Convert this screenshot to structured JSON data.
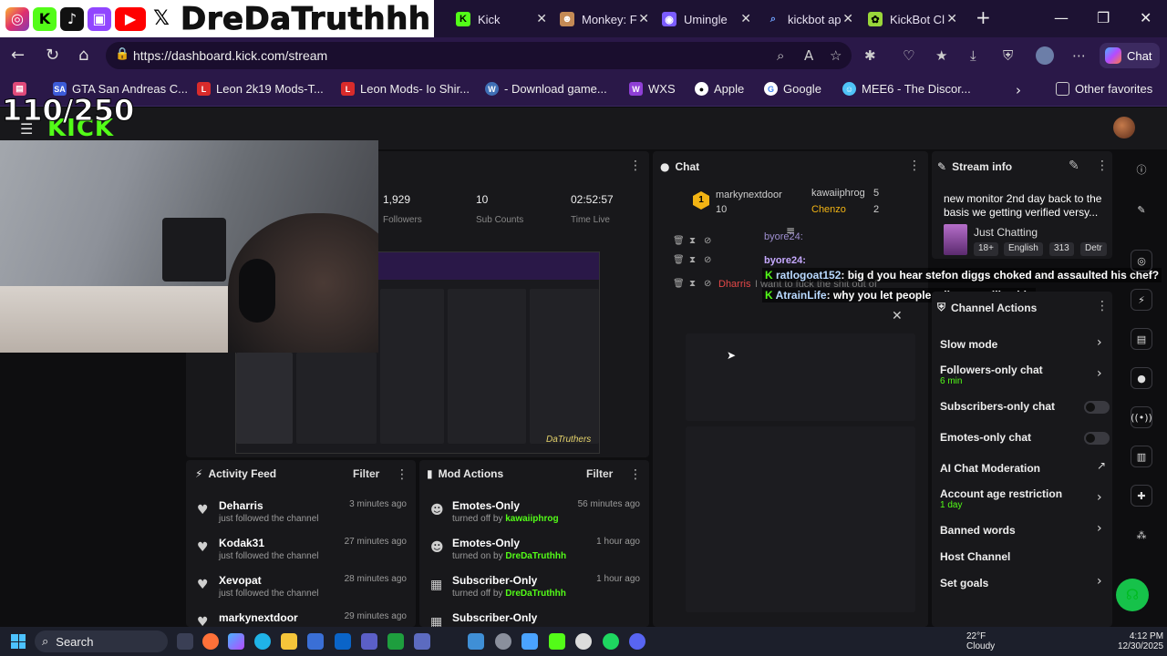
{
  "overlay": {
    "channel_name": "DreDaTruthhh",
    "viewer_goal": "110/250"
  },
  "browser": {
    "tabs": [
      {
        "label": "Kick",
        "color": "#53fc18",
        "icon": "K"
      },
      {
        "label": "Monkey: F",
        "color": "#c48a55",
        "icon": "M"
      },
      {
        "label": "Umingle",
        "color": "#7b5cff",
        "icon": "U"
      },
      {
        "label": "kickbot ap",
        "color": "#3c7bff",
        "icon": "Q"
      },
      {
        "label": "KickBot Cl",
        "color": "#9ad63a",
        "icon": "B"
      }
    ],
    "url": "https://dashboard.kick.com/stream",
    "chat_button_label": "Chat",
    "bookmarks": [
      {
        "label": "GTA San Andreas C...",
        "color": "#3c5bd8",
        "icon": "SA"
      },
      {
        "label": "Leon 2k19 Mods-T...",
        "color": "#d92b2b",
        "icon": "L"
      },
      {
        "label": "Leon Mods- Io Shir...",
        "color": "#d92b2b",
        "icon": "L"
      },
      {
        "label": "- Download game...",
        "color": "#3f6fb5",
        "icon": "W"
      },
      {
        "label": "WXS",
        "color": "#8f3fd6",
        "icon": "W"
      },
      {
        "label": "Apple",
        "color": "#333333",
        "icon": "A"
      },
      {
        "label": "Google",
        "color": "#ffffff",
        "icon": "G"
      },
      {
        "label": "MEE6 - The Discor...",
        "color": "#4fc3f7",
        "icon": "M"
      }
    ],
    "other_favorites_label": "Other favorites"
  },
  "stats": {
    "followers": "1,929",
    "followers_label": "Followers",
    "subs": "10",
    "subs_label": "Sub Counts",
    "time_live": "02:52:57",
    "time_live_label": "Time Live"
  },
  "capture_watermark": "DaTruthers",
  "activity_feed": {
    "title": "Activity Feed",
    "filter_label": "Filter",
    "items": [
      {
        "name": "Deharris",
        "action": "just followed the channel",
        "time": "3 minutes ago"
      },
      {
        "name": "Kodak31",
        "action": "just followed the channel",
        "time": "27 minutes ago"
      },
      {
        "name": "Xevopat",
        "action": "just followed the channel",
        "time": "28 minutes ago"
      },
      {
        "name": "markynextdoor",
        "action": "",
        "time": "29 minutes ago"
      }
    ]
  },
  "mod_actions": {
    "title": "Mod Actions",
    "filter_label": "Filter",
    "items": [
      {
        "name": "Emotes-Only",
        "action": "turned off by",
        "by": "kawaiiphrog",
        "time": "56 minutes ago"
      },
      {
        "name": "Emotes-Only",
        "action": "turned on by",
        "by": "DreDaTruthhh",
        "time": "1 hour ago"
      },
      {
        "name": "Subscriber-Only",
        "action": "turned off by",
        "by": "DreDaTruthhh",
        "time": "1 hour ago"
      },
      {
        "name": "Subscriber-Only",
        "action": "",
        "by": "",
        "time": ""
      }
    ]
  },
  "chat": {
    "title": "Chat",
    "top_gifters": [
      {
        "name": "markynextdoor",
        "count": "10"
      },
      {
        "name": "kawaiiphrog",
        "count": "5"
      },
      {
        "name": "Chenzo",
        "count": "2"
      }
    ],
    "partial_user_1": "byore24:",
    "partial_user_2": "byore24:",
    "deleted_user": "Dharris",
    "deleted_text": "I want to fuck the shit out of",
    "overlay_messages": [
      {
        "user": "ratlogoat152",
        "text": ": big d you hear stefon diggs choked and assaulted his chef?"
      },
      {
        "user": "AtrainLife",
        "text": ": why you let people talk to you like this"
      }
    ]
  },
  "stream_info": {
    "title_label": "Stream info",
    "stream_title": "new monitor 2nd day back to the basis we getting verified versy...",
    "category": "Just Chatting",
    "tags": [
      "18+",
      "English",
      "313",
      "Detr"
    ]
  },
  "channel_actions": {
    "title": "Channel Actions",
    "slow_mode": "Slow mode",
    "followers_only": "Followers-only chat",
    "followers_only_value": "6 min",
    "subscribers_only": "Subscribers-only chat",
    "emotes_only": "Emotes-only chat",
    "ai_moderation": "AI Chat Moderation",
    "account_age": "Account age restriction",
    "account_age_value": "1 day",
    "banned_words": "Banned words",
    "host_channel": "Host Channel",
    "set_goals": "Set goals"
  },
  "taskbar": {
    "search_label": "Search",
    "weather_temp": "22°F",
    "weather_desc": "Cloudy",
    "time": "4:12 PM",
    "date": "12/30/2025"
  },
  "colors": {
    "kick_green": "#53fc18",
    "browser_purple": "#2a1848"
  }
}
